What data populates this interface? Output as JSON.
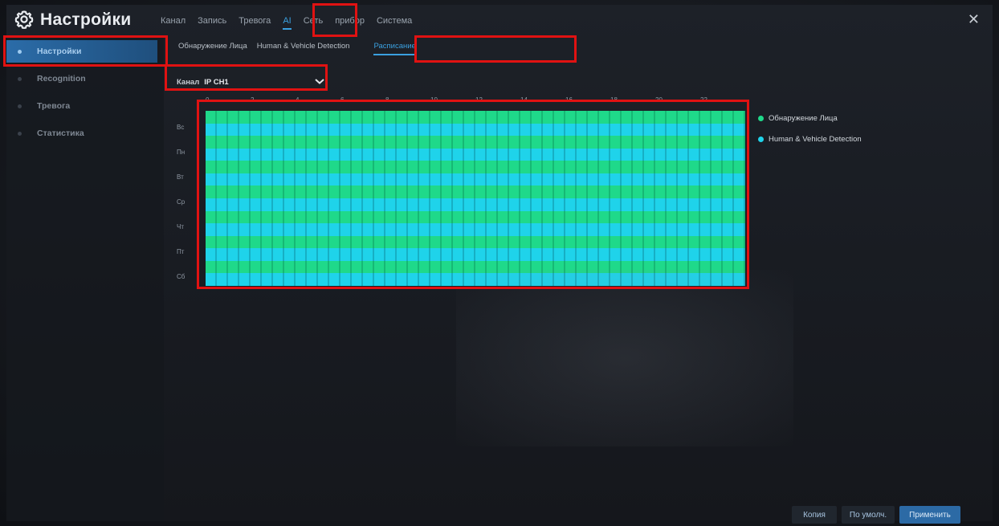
{
  "header": {
    "title": "Настройки",
    "nav": [
      "Канал",
      "Запись",
      "Тревога",
      "AI",
      "Сеть",
      "прибор",
      "Система"
    ],
    "active_nav": "AI",
    "close_symbol": "✕"
  },
  "sidebar": {
    "items": [
      {
        "label": "Настройки",
        "active": true
      },
      {
        "label": "Recognition",
        "active": false
      },
      {
        "label": "Тревога",
        "active": false
      },
      {
        "label": "Статистика",
        "active": false
      }
    ]
  },
  "subtabs": {
    "items": [
      "Обнаружение Лица",
      "Human & Vehicle Detection",
      "Расписание"
    ],
    "active": "Расписание"
  },
  "channel": {
    "label": "Канал",
    "value": "IP CH1"
  },
  "schedule": {
    "hour_labels": [
      "0",
      "2",
      "4",
      "6",
      "8",
      "10",
      "12",
      "14",
      "16",
      "18",
      "20",
      "22"
    ],
    "days": [
      "Вс",
      "Пн",
      "Вт",
      "Ср",
      "Чт",
      "Пт",
      "Сб"
    ],
    "legend": [
      {
        "label": "Обнаружение Лица",
        "color": "#1fd98a"
      },
      {
        "label": "Human & Vehicle Detection",
        "color": "#1fd3ea"
      }
    ]
  },
  "buttons": {
    "copy": "Копия",
    "default": "По умолч.",
    "apply": "Применить"
  },
  "colors": {
    "accent": "#3aa0e0",
    "annotation": "#e01212"
  }
}
